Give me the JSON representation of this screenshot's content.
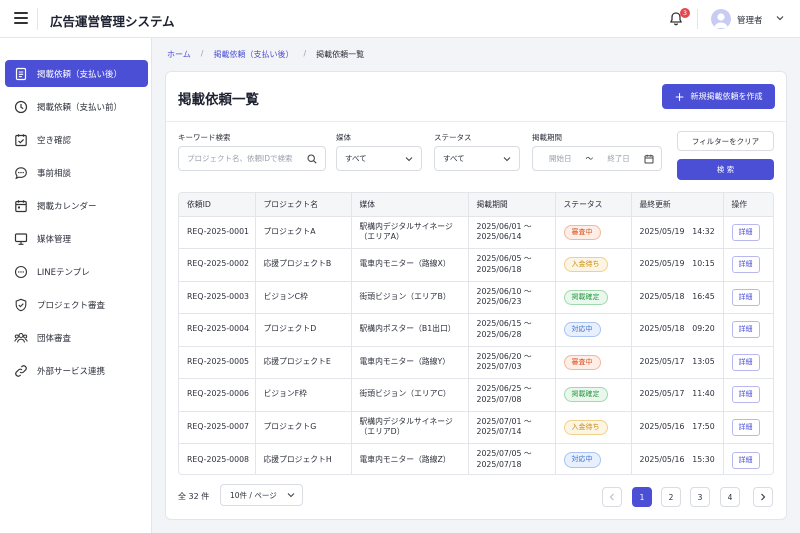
{
  "header": {
    "app_title": "広告運営管理システム",
    "notification_count": "3",
    "user_name": "管理者"
  },
  "sidebar": {
    "items": [
      {
        "label": "掲載依頼（支払い後）",
        "icon": "document-icon",
        "active": true
      },
      {
        "label": "掲載依頼（支払い前）",
        "icon": "clock-icon",
        "active": false
      },
      {
        "label": "空き確認",
        "icon": "calendar-check-icon",
        "active": false
      },
      {
        "label": "事前相談",
        "icon": "chat-icon",
        "active": false
      },
      {
        "label": "掲載カレンダー",
        "icon": "calendar-icon",
        "active": false
      },
      {
        "label": "媒体管理",
        "icon": "monitor-icon",
        "active": false
      },
      {
        "label": "LINEテンプレ",
        "icon": "chat-dots-icon",
        "active": false
      },
      {
        "label": "プロジェクト審査",
        "icon": "shield-check-icon",
        "active": false
      },
      {
        "label": "団体審査",
        "icon": "users-icon",
        "active": false
      },
      {
        "label": "外部サービス連携",
        "icon": "link-icon",
        "active": false
      }
    ]
  },
  "breadcrumb": {
    "home": "ホーム",
    "parent": "掲載依頼（支払い後）",
    "current": "掲載依頼一覧"
  },
  "page": {
    "title": "掲載依頼一覧",
    "new_button": "新規掲載依頼を作成"
  },
  "filters": {
    "keyword_label": "キーワード検索",
    "keyword_placeholder": "プロジェクト名、依頼IDで検索",
    "media_label": "媒体",
    "media_value": "すべて",
    "status_label": "ステータス",
    "status_value": "すべて",
    "period_label": "掲載期間",
    "start_placeholder": "開始日",
    "period_sep": "〜",
    "end_placeholder": "終了日",
    "clear_button": "フィルターをクリア",
    "search_button": "検 索"
  },
  "table": {
    "headers": [
      "依頼ID",
      "プロジェクト名",
      "媒体",
      "掲載期間",
      "ステータス",
      "最終更新",
      "操作"
    ],
    "detail_label": "詳細",
    "rows": [
      {
        "id": "REQ-2025-0001",
        "project": "プロジェクトA",
        "media": "駅構内デジタルサイネージ（エリアA）",
        "period_start": "2025/06/01 〜",
        "period_end": "2025/06/14",
        "status": "審査中",
        "status_type": "review",
        "updated": "2025/05/19　14:32"
      },
      {
        "id": "REQ-2025-0002",
        "project": "応援プロジェクトB",
        "media": "電車内モニター（路線X）",
        "period_start": "2025/06/05 〜",
        "period_end": "2025/06/18",
        "status": "入金待ち",
        "status_type": "pay",
        "updated": "2025/05/19　10:15"
      },
      {
        "id": "REQ-2025-0003",
        "project": "ビジョンC枠",
        "media": "街頭ビジョン（エリアB）",
        "period_start": "2025/06/10 〜",
        "period_end": "2025/06/23",
        "status": "掲載確定",
        "status_type": "ok",
        "updated": "2025/05/18　16:45"
      },
      {
        "id": "REQ-2025-0004",
        "project": "プロジェクトD",
        "media": "駅構内ポスター（B1出口）",
        "period_start": "2025/06/15 〜",
        "period_end": "2025/06/28",
        "status": "対応中",
        "status_type": "resp",
        "updated": "2025/05/18　09:20"
      },
      {
        "id": "REQ-2025-0005",
        "project": "応援プロジェクトE",
        "media": "電車内モニター（路線Y）",
        "period_start": "2025/06/20 〜",
        "period_end": "2025/07/03",
        "status": "審査中",
        "status_type": "review",
        "updated": "2025/05/17　13:05"
      },
      {
        "id": "REQ-2025-0006",
        "project": "ビジョンF枠",
        "media": "街頭ビジョン（エリアC）",
        "period_start": "2025/06/25 〜",
        "period_end": "2025/07/08",
        "status": "掲載確定",
        "status_type": "ok",
        "updated": "2025/05/17　11:40"
      },
      {
        "id": "REQ-2025-0007",
        "project": "プロジェクトG",
        "media": "駅構内デジタルサイネージ（エリアD）",
        "period_start": "2025/07/01 〜",
        "period_end": "2025/07/14",
        "status": "入金待ち",
        "status_type": "pay",
        "updated": "2025/05/16　17:50"
      },
      {
        "id": "REQ-2025-0008",
        "project": "応援プロジェクトH",
        "media": "電車内モニター（路線Z）",
        "period_start": "2025/07/05 〜",
        "period_end": "2025/07/18",
        "status": "対応中",
        "status_type": "resp",
        "updated": "2025/05/16　15:30"
      }
    ]
  },
  "footer": {
    "total": "全 32 件",
    "per_page": "10件 / ページ",
    "pages": [
      "1",
      "2",
      "3",
      "4"
    ],
    "current_page": "1"
  },
  "colors": {
    "accent": "#4b4fd6",
    "review": "#d9541f",
    "pay": "#c98a0d",
    "ok": "#2e9a4a",
    "resp": "#3a6fd8"
  }
}
